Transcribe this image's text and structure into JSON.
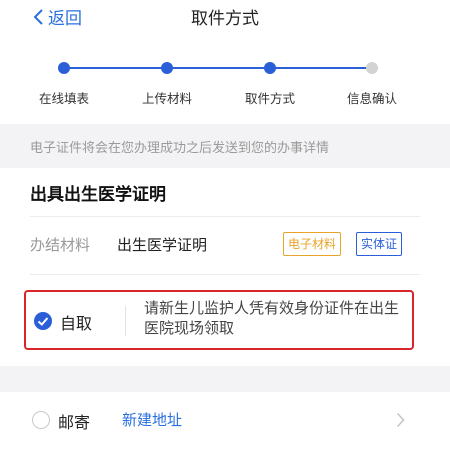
{
  "header": {
    "back_label": "返回",
    "title": "取件方式"
  },
  "steps": [
    {
      "label": "在线填表",
      "state": "done"
    },
    {
      "label": "上传材料",
      "state": "done"
    },
    {
      "label": "取件方式",
      "state": "current"
    },
    {
      "label": "信息确认",
      "state": "pending"
    }
  ],
  "notice": "电子证件将会在您办理成功之后发送到您的办事详情",
  "document": {
    "title": "出具出生医学证明",
    "material_label": "办结材料",
    "material_value": "出生医学证明",
    "tags": [
      "电子材料",
      "实体证"
    ]
  },
  "pickup_option": {
    "name": "自取",
    "selected": true,
    "description": "请新生儿监护人凭有效身份证件在出生医院现场领取"
  },
  "mail_option": {
    "name": "邮寄",
    "selected": false,
    "link": "新建地址"
  },
  "colors": {
    "accent": "#2a5fd8",
    "link": "#2a6fe0",
    "highlight_border": "#d9262a",
    "tag_orange": "#e8a42a"
  }
}
